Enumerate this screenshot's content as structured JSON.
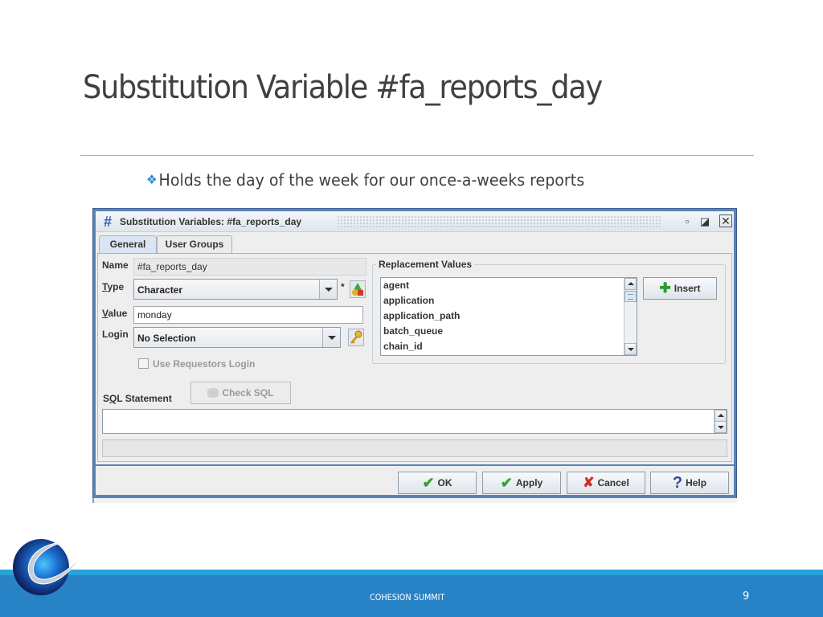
{
  "slide": {
    "title": "Substitution Variable #fa_reports_day",
    "bullet": "Holds the day of the week for our once-a-weeks reports",
    "bullet_icon": "diamond-bullet-icon",
    "footer_text": "COHESION SUMMIT",
    "page_number": "9",
    "colors": {
      "footer": "#2882c6",
      "footer_accent": "#29a3dc",
      "bullet": "#2a90d4",
      "title": "#404040"
    }
  },
  "dialog": {
    "title": "Substitution Variables: #fa_reports_day",
    "window_controls": {
      "minimize": "▫",
      "maximize": "◪",
      "close": "☒"
    },
    "tabs": [
      {
        "label": "General",
        "active": true
      },
      {
        "label": "User Groups",
        "active": false
      }
    ],
    "fields": {
      "name": {
        "label": "Name",
        "value": "#fa_reports_day"
      },
      "type": {
        "label_mnemonic": "T",
        "label_rest": "ype",
        "value": "Character",
        "required_marker": "*"
      },
      "value": {
        "label_mnemonic": "V",
        "label_rest": "alue",
        "value": "monday"
      },
      "login": {
        "label": "Login",
        "value": "No Selection"
      }
    },
    "use_requestors_login": {
      "label": "Use Requestors Login",
      "checked": false,
      "enabled": false
    },
    "sql": {
      "label_pre": "S",
      "label_mnemonic": "Q",
      "label_rest": "L Statement",
      "value": "",
      "check_button": "Check SQL"
    },
    "replacement_values": {
      "title": "Replacement Values",
      "items": [
        "agent",
        "application",
        "application_path",
        "batch_queue",
        "chain_id"
      ],
      "insert_button": "Insert"
    },
    "buttons": {
      "ok": "OK",
      "apply": "Apply",
      "cancel": "Cancel",
      "help": "Help"
    }
  }
}
